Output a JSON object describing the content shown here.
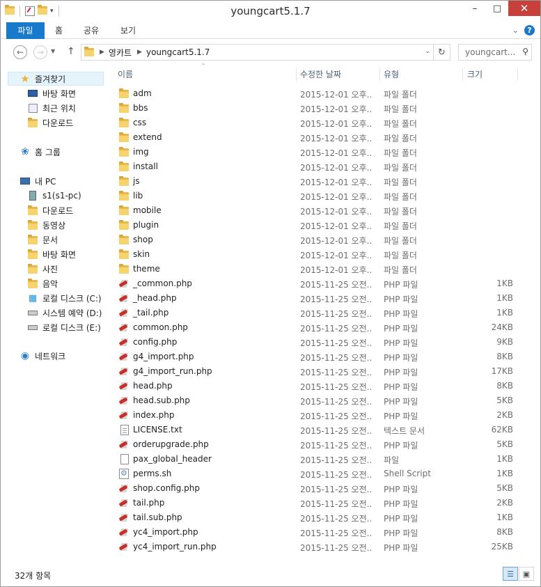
{
  "window": {
    "title": "youngcart5.1.7"
  },
  "ribbon": {
    "tabs": [
      "파일",
      "홈",
      "공유",
      "보기"
    ]
  },
  "address": {
    "crumbs": [
      "영카트",
      "youngcart5.1.7"
    ],
    "search_placeholder": "youngcart..."
  },
  "nav": {
    "favorites": {
      "label": "즐겨찾기",
      "items": [
        "바탕 화면",
        "최근 위치",
        "다운로드"
      ]
    },
    "homegroup": "홈 그룹",
    "pc": {
      "label": "내 PC",
      "items": [
        "s1(s1-pc)",
        "다운로드",
        "동영상",
        "문서",
        "바탕 화면",
        "사진",
        "음악",
        "로컬 디스크 (C:)",
        "시스템 예약 (D:)",
        "로컬 디스크 (E:)"
      ]
    },
    "network": "네트워크"
  },
  "columns": {
    "name": "이름",
    "date": "수정한 날짜",
    "type": "유형",
    "size": "크기"
  },
  "files": [
    {
      "name": "adm",
      "date": "2015-12-01 오후...",
      "type": "파일 폴더",
      "size": "",
      "kind": "folder"
    },
    {
      "name": "bbs",
      "date": "2015-12-01 오후...",
      "type": "파일 폴더",
      "size": "",
      "kind": "folder"
    },
    {
      "name": "css",
      "date": "2015-12-01 오후...",
      "type": "파일 폴더",
      "size": "",
      "kind": "folder"
    },
    {
      "name": "extend",
      "date": "2015-12-01 오후...",
      "type": "파일 폴더",
      "size": "",
      "kind": "folder"
    },
    {
      "name": "img",
      "date": "2015-12-01 오후...",
      "type": "파일 폴더",
      "size": "",
      "kind": "folder"
    },
    {
      "name": "install",
      "date": "2015-12-01 오후...",
      "type": "파일 폴더",
      "size": "",
      "kind": "folder"
    },
    {
      "name": "js",
      "date": "2015-12-01 오후...",
      "type": "파일 폴더",
      "size": "",
      "kind": "folder"
    },
    {
      "name": "lib",
      "date": "2015-12-01 오후...",
      "type": "파일 폴더",
      "size": "",
      "kind": "folder"
    },
    {
      "name": "mobile",
      "date": "2015-12-01 오후...",
      "type": "파일 폴더",
      "size": "",
      "kind": "folder"
    },
    {
      "name": "plugin",
      "date": "2015-12-01 오후...",
      "type": "파일 폴더",
      "size": "",
      "kind": "folder"
    },
    {
      "name": "shop",
      "date": "2015-12-01 오후...",
      "type": "파일 폴더",
      "size": "",
      "kind": "folder"
    },
    {
      "name": "skin",
      "date": "2015-12-01 오후...",
      "type": "파일 폴더",
      "size": "",
      "kind": "folder"
    },
    {
      "name": "theme",
      "date": "2015-12-01 오후...",
      "type": "파일 폴더",
      "size": "",
      "kind": "folder"
    },
    {
      "name": "_common.php",
      "date": "2015-11-25 오전...",
      "type": "PHP 파일",
      "size": "1KB",
      "kind": "php"
    },
    {
      "name": "_head.php",
      "date": "2015-11-25 오전...",
      "type": "PHP 파일",
      "size": "1KB",
      "kind": "php"
    },
    {
      "name": "_tail.php",
      "date": "2015-11-25 오전...",
      "type": "PHP 파일",
      "size": "1KB",
      "kind": "php"
    },
    {
      "name": "common.php",
      "date": "2015-11-25 오전...",
      "type": "PHP 파일",
      "size": "24KB",
      "kind": "php"
    },
    {
      "name": "config.php",
      "date": "2015-11-25 오전...",
      "type": "PHP 파일",
      "size": "9KB",
      "kind": "php"
    },
    {
      "name": "g4_import.php",
      "date": "2015-11-25 오전...",
      "type": "PHP 파일",
      "size": "8KB",
      "kind": "php"
    },
    {
      "name": "g4_import_run.php",
      "date": "2015-11-25 오전...",
      "type": "PHP 파일",
      "size": "17KB",
      "kind": "php"
    },
    {
      "name": "head.php",
      "date": "2015-11-25 오전...",
      "type": "PHP 파일",
      "size": "8KB",
      "kind": "php"
    },
    {
      "name": "head.sub.php",
      "date": "2015-11-25 오전...",
      "type": "PHP 파일",
      "size": "5KB",
      "kind": "php"
    },
    {
      "name": "index.php",
      "date": "2015-11-25 오전...",
      "type": "PHP 파일",
      "size": "2KB",
      "kind": "php"
    },
    {
      "name": "LICENSE.txt",
      "date": "2015-11-25 오전...",
      "type": "텍스트 문서",
      "size": "62KB",
      "kind": "txt"
    },
    {
      "name": "orderupgrade.php",
      "date": "2015-11-25 오전...",
      "type": "PHP 파일",
      "size": "5KB",
      "kind": "php"
    },
    {
      "name": "pax_global_header",
      "date": "2015-11-25 오전...",
      "type": "파일",
      "size": "1KB",
      "kind": "blank"
    },
    {
      "name": "perms.sh",
      "date": "2015-11-25 오전...",
      "type": "Shell Script",
      "size": "1KB",
      "kind": "sh"
    },
    {
      "name": "shop.config.php",
      "date": "2015-11-25 오전...",
      "type": "PHP 파일",
      "size": "5KB",
      "kind": "php"
    },
    {
      "name": "tail.php",
      "date": "2015-11-25 오전...",
      "type": "PHP 파일",
      "size": "2KB",
      "kind": "php"
    },
    {
      "name": "tail.sub.php",
      "date": "2015-11-25 오전...",
      "type": "PHP 파일",
      "size": "1KB",
      "kind": "php"
    },
    {
      "name": "yc4_import.php",
      "date": "2015-11-25 오전...",
      "type": "PHP 파일",
      "size": "8KB",
      "kind": "php"
    },
    {
      "name": "yc4_import_run.php",
      "date": "2015-11-25 오전...",
      "type": "PHP 파일",
      "size": "25KB",
      "kind": "php"
    }
  ],
  "status": {
    "count": "32개 항목"
  }
}
